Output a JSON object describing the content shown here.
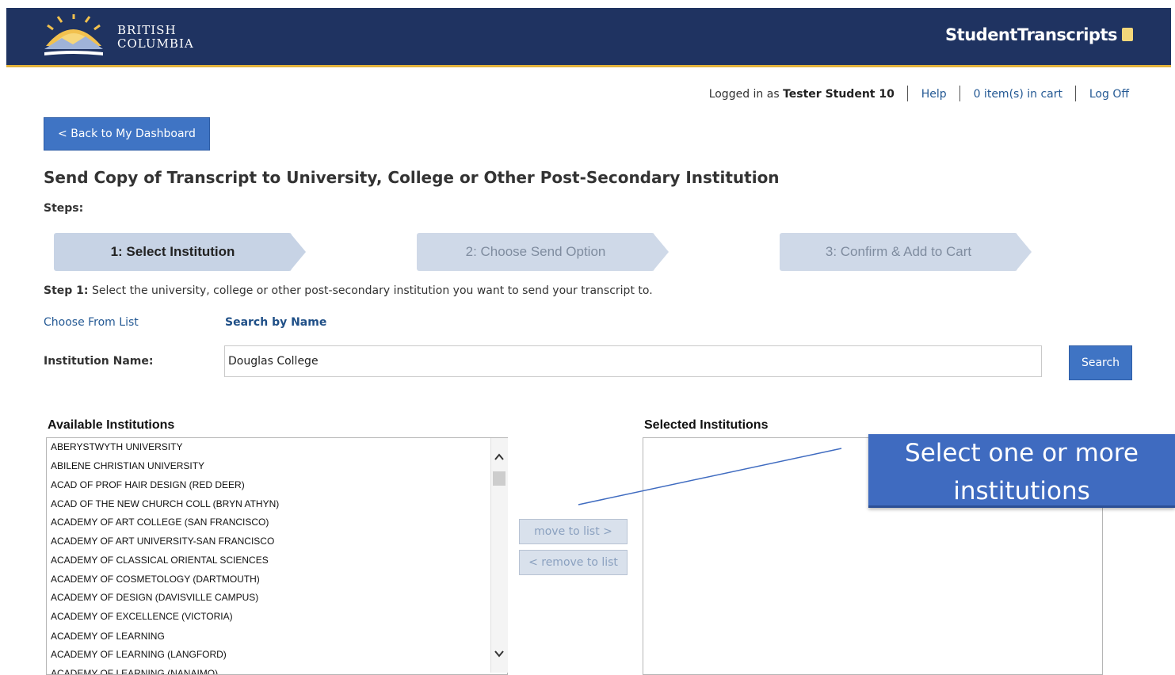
{
  "header": {
    "logo_line1": "BRITISH",
    "logo_line2": "COLUMBIA",
    "app_title": "StudentTranscripts"
  },
  "userbar": {
    "logged_in_prefix": "Logged in as",
    "user_name": "Tester Student 10",
    "help": "Help",
    "cart": "0 item(s) in cart",
    "log_off": "Log Off"
  },
  "back_button": "< Back to My Dashboard",
  "page_title": "Send Copy of Transcript to University, College or Other Post-Secondary Institution",
  "steps_label": "Steps:",
  "steps": [
    {
      "label": "1: Select Institution",
      "active": true
    },
    {
      "label": "2: Choose Send Option",
      "active": false
    },
    {
      "label": "3: Confirm & Add to Cart",
      "active": false
    }
  ],
  "instruction": {
    "prefix": "Step 1:",
    "text": "Select the university, college or other post-secondary institution you want to send your transcript to."
  },
  "tabs": {
    "choose_from_list": "Choose From List",
    "search_by_name": "Search by Name"
  },
  "institution_field": {
    "label": "Institution Name:",
    "value": "Douglas College"
  },
  "search_button": "Search",
  "available": {
    "title": "Available Institutions",
    "items": [
      "ABERYSTWYTH UNIVERSITY",
      "ABILENE CHRISTIAN UNIVERSITY",
      "ACAD OF PROF HAIR DESIGN (RED DEER)",
      "ACAD OF THE NEW CHURCH COLL (BRYN ATHYN)",
      "ACADEMY OF ART COLLEGE (SAN FRANCISCO)",
      "ACADEMY OF ART UNIVERSITY-SAN FRANCISCO",
      "ACADEMY OF CLASSICAL ORIENTAL SCIENCES",
      "ACADEMY OF COSMETOLOGY (DARTMOUTH)",
      "ACADEMY OF DESIGN (DAVISVILLE CAMPUS)",
      "ACADEMY OF EXCELLENCE (VICTORIA)",
      "ACADEMY OF LEARNING",
      "ACADEMY OF LEARNING (LANGFORD)",
      "ACADEMY OF LEARNING (NANAIMO)"
    ]
  },
  "move_button": "move to list >",
  "remove_button": "< remove to list",
  "selected": {
    "title": "Selected Institutions"
  },
  "callout": {
    "line1": "Select one or more",
    "line2": "institutions"
  },
  "colors": {
    "header_bg": "#1f3361",
    "accent_gold": "#e2b23c",
    "primary_button": "#3f74c4",
    "callout_bg": "#3f6bc0"
  }
}
